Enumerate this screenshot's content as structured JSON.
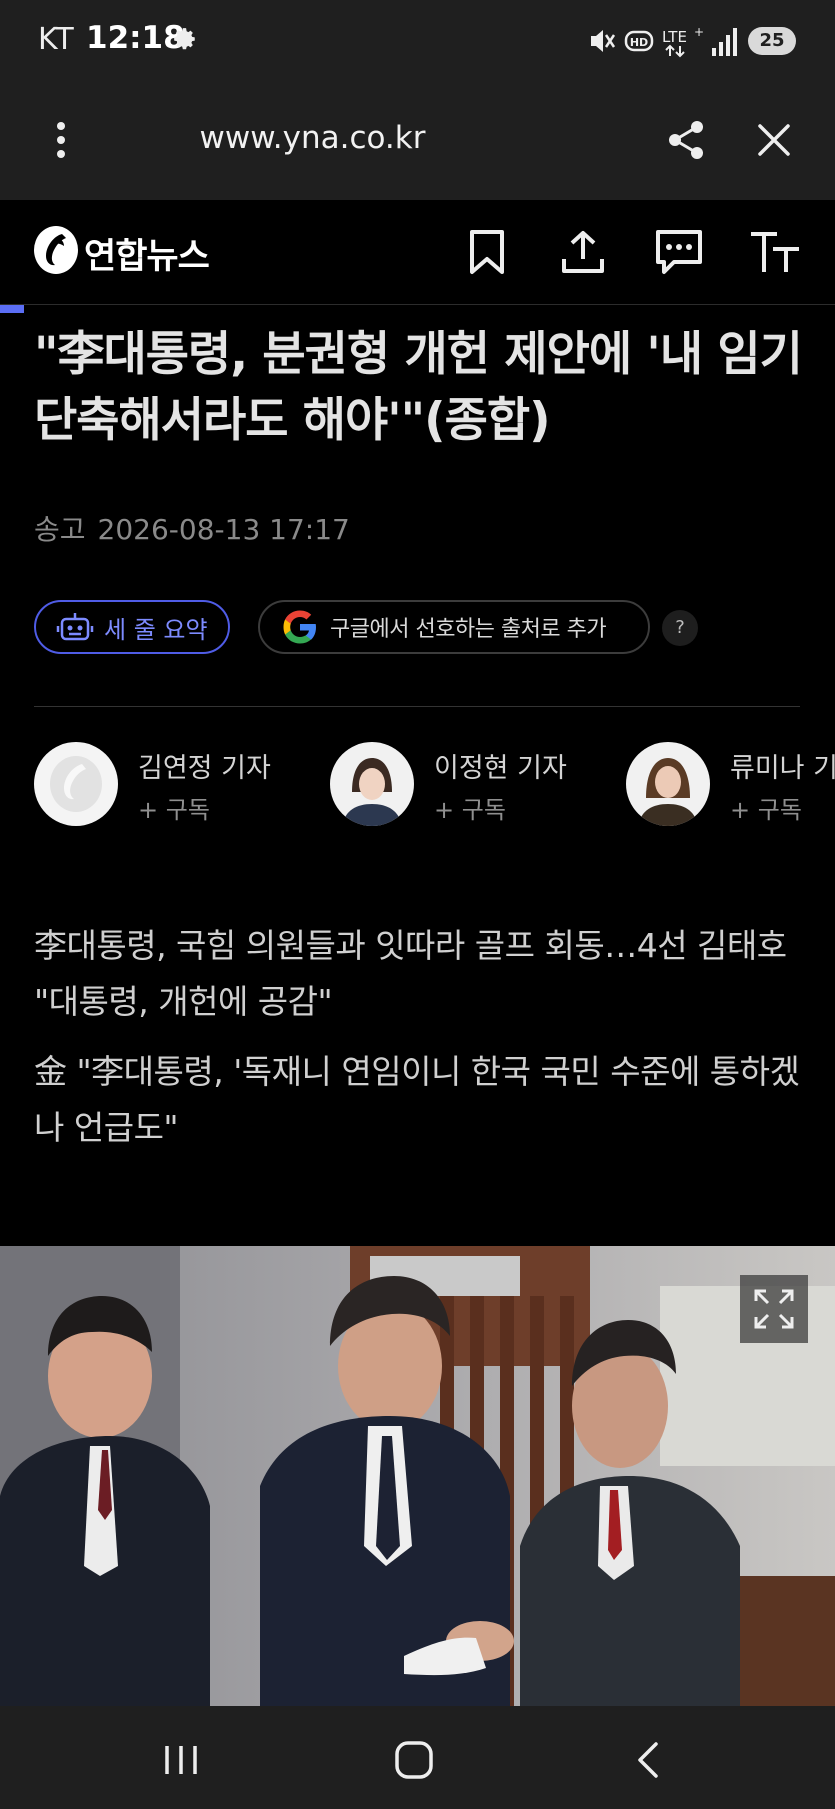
{
  "status_bar": {
    "carrier": "KT",
    "time": "12:18",
    "battery": "25",
    "icons": [
      "gear-icon",
      "mute-icon",
      "hd-icon",
      "lte-plus-icon",
      "signal-icon",
      "battery-icon"
    ]
  },
  "browser": {
    "url": "www.yna.co.kr",
    "icons": [
      "more-vertical-icon",
      "share-icon",
      "close-icon"
    ]
  },
  "site": {
    "logo_text": "연합뉴스",
    "header_icons": [
      "bookmark-icon",
      "upload-icon",
      "comment-icon",
      "text-size-icon"
    ]
  },
  "article": {
    "headline": "\"李대통령, 분권형 개헌 제안에 '내 임기 단축해서라도 해야'\"(종합)",
    "date_label": "송고",
    "date": "2026-08-13 17:17",
    "summary_chip": "세 줄 요약",
    "google_chip": "구글에서 선호하는 출처로 추가",
    "help": "?",
    "reporters": [
      {
        "name": "김연정 기자",
        "subscribe": "+ 구독"
      },
      {
        "name": "이정현 기자",
        "subscribe": "+ 구독"
      },
      {
        "name": "류미나 기자",
        "subscribe": "+ 구독"
      }
    ],
    "summary_lines": [
      "李대통령, 국힘 의원들과 잇따라 골프 회동…4선 김태호 \"대통령, 개헌에 공감\"",
      "金 \"李대통령, '독재니 연임이니 한국 국민 수준에 통하겠나 언급도\""
    ]
  },
  "photo": {
    "expand_icon": "expand-icon"
  },
  "nav": {
    "icons": [
      "recent-apps-icon",
      "home-icon",
      "back-icon"
    ]
  },
  "colors": {
    "accent": "#5b6ef5",
    "chip_text": "#7d8bff",
    "background": "#000000",
    "bar": "#1f1f1f"
  }
}
